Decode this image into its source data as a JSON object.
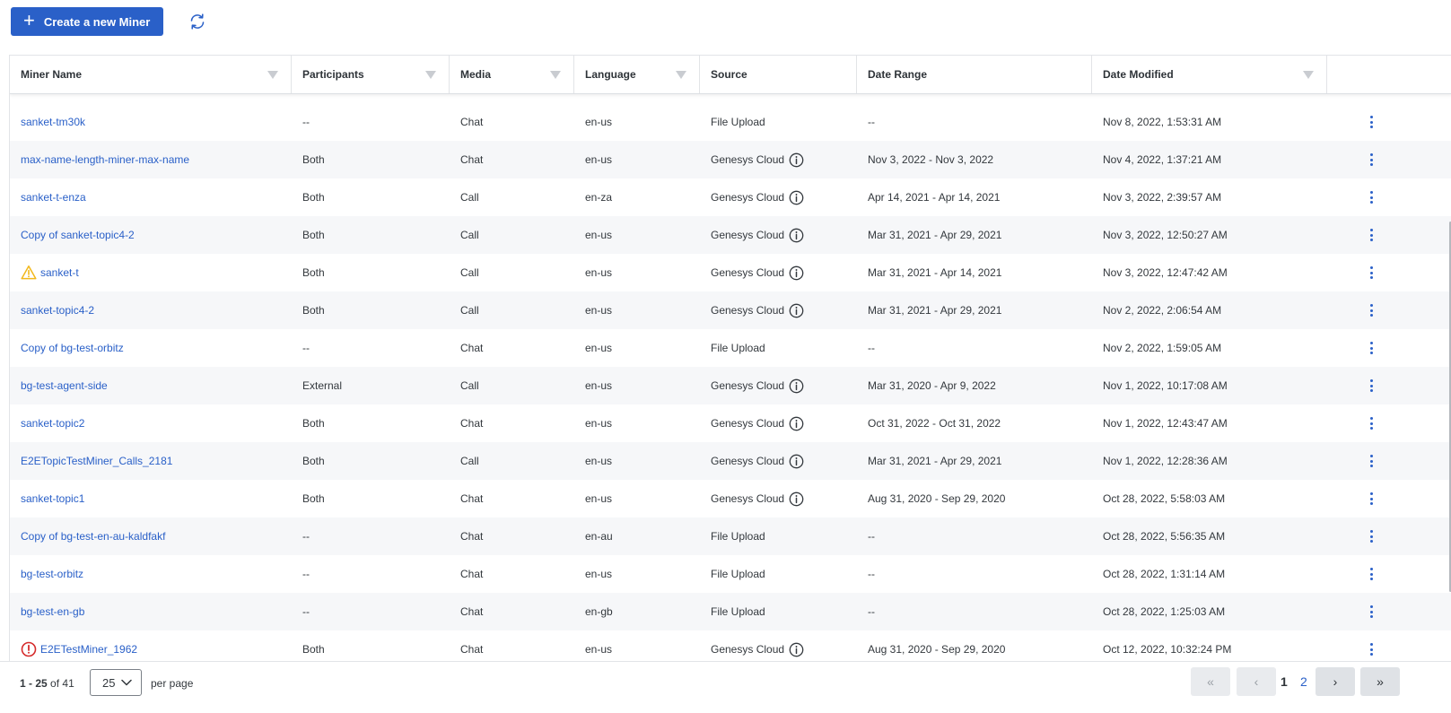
{
  "toolbar": {
    "create_label": "Create a new Miner"
  },
  "table": {
    "headers": [
      "Miner Name",
      "Participants",
      "Media",
      "Language",
      "Source",
      "Date Range",
      "Date Modified"
    ],
    "rows": [
      {
        "name": "sanket-tm30k",
        "participants": "--",
        "media": "Chat",
        "language": "en-us",
        "source": "File Upload",
        "date_range": "--",
        "modified": "Nov 8, 2022, 1:53:31 AM",
        "status": "none",
        "info": false
      },
      {
        "name": "max-name-length-miner-max-name",
        "participants": "Both",
        "media": "Chat",
        "language": "en-us",
        "source": "Genesys Cloud",
        "date_range": "Nov 3, 2022 - Nov 3, 2022",
        "modified": "Nov 4, 2022, 1:37:21 AM",
        "status": "none",
        "info": true
      },
      {
        "name": "sanket-t-enza",
        "participants": "Both",
        "media": "Call",
        "language": "en-za",
        "source": "Genesys Cloud",
        "date_range": "Apr 14, 2021 - Apr 14, 2021",
        "modified": "Nov 3, 2022, 2:39:57 AM",
        "status": "none",
        "info": true
      },
      {
        "name": "Copy of sanket-topic4-2",
        "participants": "Both",
        "media": "Call",
        "language": "en-us",
        "source": "Genesys Cloud",
        "date_range": "Mar 31, 2021 - Apr 29, 2021",
        "modified": "Nov 3, 2022, 12:50:27 AM",
        "status": "none",
        "info": true
      },
      {
        "name": "sanket-t",
        "participants": "Both",
        "media": "Call",
        "language": "en-us",
        "source": "Genesys Cloud",
        "date_range": "Mar 31, 2021 - Apr 14, 2021",
        "modified": "Nov 3, 2022, 12:47:42 AM",
        "status": "warning",
        "info": true
      },
      {
        "name": "sanket-topic4-2",
        "participants": "Both",
        "media": "Call",
        "language": "en-us",
        "source": "Genesys Cloud",
        "date_range": "Mar 31, 2021 - Apr 29, 2021",
        "modified": "Nov 2, 2022, 2:06:54 AM",
        "status": "none",
        "info": true
      },
      {
        "name": "Copy of bg-test-orbitz",
        "participants": "--",
        "media": "Chat",
        "language": "en-us",
        "source": "File Upload",
        "date_range": "--",
        "modified": "Nov 2, 2022, 1:59:05 AM",
        "status": "none",
        "info": false
      },
      {
        "name": "bg-test-agent-side",
        "participants": "External",
        "media": "Call",
        "language": "en-us",
        "source": "Genesys Cloud",
        "date_range": "Mar 31, 2020 - Apr 9, 2022",
        "modified": "Nov 1, 2022, 10:17:08 AM",
        "status": "none",
        "info": true
      },
      {
        "name": "sanket-topic2",
        "participants": "Both",
        "media": "Chat",
        "language": "en-us",
        "source": "Genesys Cloud",
        "date_range": "Oct 31, 2022 - Oct 31, 2022",
        "modified": "Nov 1, 2022, 12:43:47 AM",
        "status": "none",
        "info": true
      },
      {
        "name": "E2ETopicTestMiner_Calls_2181",
        "participants": "Both",
        "media": "Call",
        "language": "en-us",
        "source": "Genesys Cloud",
        "date_range": "Mar 31, 2021 - Apr 29, 2021",
        "modified": "Nov 1, 2022, 12:28:36 AM",
        "status": "none",
        "info": true
      },
      {
        "name": "sanket-topic1",
        "participants": "Both",
        "media": "Chat",
        "language": "en-us",
        "source": "Genesys Cloud",
        "date_range": "Aug 31, 2020 - Sep 29, 2020",
        "modified": "Oct 28, 2022, 5:58:03 AM",
        "status": "none",
        "info": true
      },
      {
        "name": "Copy of bg-test-en-au-kaldfakf",
        "participants": "--",
        "media": "Chat",
        "language": "en-au",
        "source": "File Upload",
        "date_range": "--",
        "modified": "Oct 28, 2022, 5:56:35 AM",
        "status": "none",
        "info": false
      },
      {
        "name": "bg-test-orbitz",
        "participants": "--",
        "media": "Chat",
        "language": "en-us",
        "source": "File Upload",
        "date_range": "--",
        "modified": "Oct 28, 2022, 1:31:14 AM",
        "status": "none",
        "info": false
      },
      {
        "name": "bg-test-en-gb",
        "participants": "--",
        "media": "Chat",
        "language": "en-gb",
        "source": "File Upload",
        "date_range": "--",
        "modified": "Oct 28, 2022, 1:25:03 AM",
        "status": "none",
        "info": false
      },
      {
        "name": "E2ETestMiner_1962",
        "participants": "Both",
        "media": "Chat",
        "language": "en-us",
        "source": "Genesys Cloud",
        "date_range": "Aug 31, 2020 - Sep 29, 2020",
        "modified": "Oct 12, 2022, 10:32:24 PM",
        "status": "error",
        "info": true
      }
    ]
  },
  "footer": {
    "range_start_end": "1 - 25",
    "of_label": "of",
    "total": "41",
    "per_page_value": "25",
    "per_page_label": "per page",
    "pages": [
      "1",
      "2"
    ],
    "first_symbol": "«",
    "prev_symbol": "‹",
    "next_symbol": "›",
    "last_symbol": "»"
  },
  "icons": {
    "create": "plus-icon",
    "refresh": "refresh-icon",
    "warning": "warning-icon",
    "error": "error-icon",
    "info": "info-icon",
    "more": "kebab-icon",
    "dropdown": "chevron-down-icon"
  },
  "colors": {
    "primary": "#2a60c8",
    "warning": "#f2b81c",
    "error": "#d52b2b",
    "row_stripe": "#f6f7f9"
  }
}
